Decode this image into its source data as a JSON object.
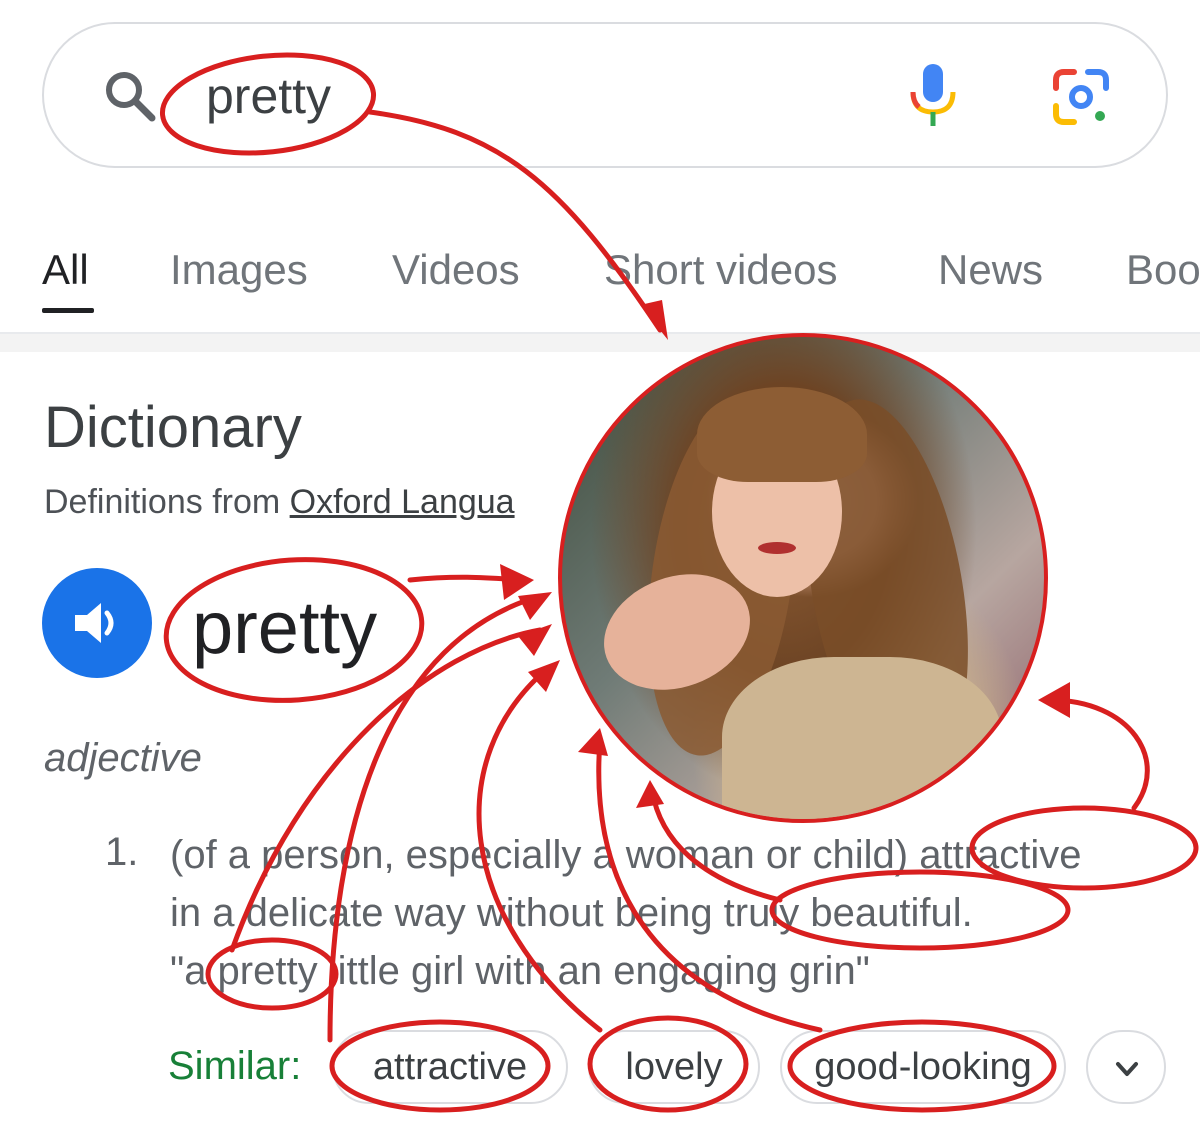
{
  "search": {
    "query": "pretty"
  },
  "tabs": [
    {
      "label": "All",
      "active": true
    },
    {
      "label": "Images"
    },
    {
      "label": "Videos"
    },
    {
      "label": "Short videos"
    },
    {
      "label": "News"
    },
    {
      "label": "Boo"
    }
  ],
  "dictionary": {
    "heading": "Dictionary",
    "source_prefix": "Definitions from ",
    "source_link": "Oxford Langua",
    "word": "pretty",
    "part_of_speech": "adjective",
    "definition": {
      "number": "1.",
      "lines": [
        "(of a person, especially a woman or child) attractive",
        "in a delicate way without being truly beautiful.",
        "\"a pretty little girl with an engaging grin\""
      ]
    },
    "similar_label": "Similar:",
    "similar": [
      "attractive",
      "lovely",
      "good-looking"
    ]
  },
  "colors": {
    "accent_blue": "#1a73e8",
    "annotation_red": "#d81f1f",
    "similar_green": "#188038"
  },
  "icons": [
    "search-icon",
    "microphone-icon",
    "google-lens-icon",
    "speaker-icon",
    "chevron-down-icon"
  ]
}
